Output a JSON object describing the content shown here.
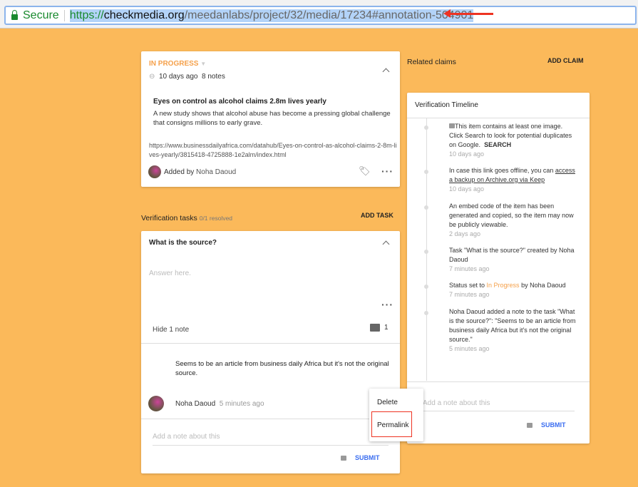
{
  "browser": {
    "secure_label": "Secure",
    "url_scheme": "https://",
    "url_domain": "checkmedia.org",
    "url_path": "/meedanlabs/project/32/media/17234#annotation-504901"
  },
  "media": {
    "status": "IN PROGRESS",
    "age": "10 days ago",
    "notes": "8 notes",
    "title": "Eyes on control as alcohol claims 2.8m lives yearly",
    "description": "A new study shows that alcohol abuse has become a pressing global challenge that consigns millions to early grave.",
    "link": "https://www.businessdailyafrica.com/datahub/Eyes-on-control-as-alcohol-claims-2-8m-lives-yearly/3815418-4725888-1e2alm/index.html",
    "added_by_prefix": "Added by",
    "added_by": "Noha Daoud"
  },
  "claims": {
    "label": "Related claims",
    "add": "ADD CLAIM"
  },
  "tasks": {
    "label": "Verification tasks",
    "resolved": "0/1 resolved",
    "add": "ADD TASK",
    "question": "What is the source?",
    "answer_placeholder": "Answer here.",
    "hide_notes": "Hide 1 note",
    "note_count": "1",
    "note_text": "Seems to be an article from business daily Africa but it's not the original source.",
    "note_author": "Noha Daoud",
    "note_time": "5 minutes ago",
    "add_note_placeholder": "Add a note about this",
    "submit": "SUBMIT"
  },
  "menu": {
    "items": [
      "Delete",
      "Permalink"
    ]
  },
  "timeline": {
    "title": "Verification Timeline",
    "items": [
      {
        "text": "This item contains at least one image. Click Search to look for potential duplicates on Google.",
        "action": "SEARCH",
        "time": "10 days ago"
      },
      {
        "text": "In case this link goes offline, you can ",
        "link": "access a backup on Archive.org via Keep",
        "time": "10 days ago"
      },
      {
        "text": "An embed code of the item has been generated and copied, so the item may now be publicly viewable.",
        "time": "2 days ago"
      },
      {
        "text": "Task \"What is the source?\" created by Noha Daoud",
        "time": "7 minutes ago"
      },
      {
        "pre": "Status set to ",
        "status": "In Progress",
        "post": " by Noha Daoud",
        "time": "7 minutes ago"
      },
      {
        "text": "Noha Daoud added a note to the task \"What is the source?\": \"Seems to be an article from business daily Africa but it's not the original source.\"",
        "time": "5 minutes ago"
      }
    ],
    "add_note_placeholder": "Add a note about this",
    "submit": "SUBMIT"
  },
  "colors": {
    "background": "#fbb95a",
    "status": "#f5a04a",
    "submit": "#3a6df0",
    "highlight_box": "#e32"
  }
}
